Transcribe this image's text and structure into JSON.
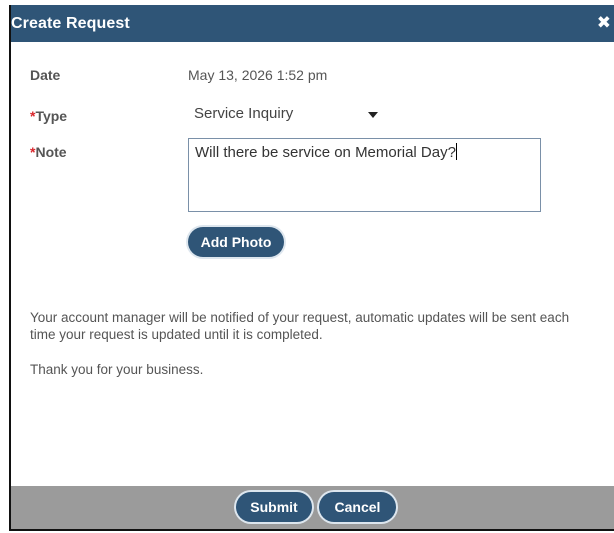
{
  "dialog": {
    "title": "Create Request",
    "close_symbol": "✖"
  },
  "form": {
    "date_label": "Date",
    "date_value": "May 13, 2026 1:52 pm",
    "required_mark": "*",
    "type_label": "Type",
    "type_value": "Service Inquiry",
    "note_label": "Note",
    "note_value": "Will there be service on Memorial Day?",
    "add_photo_label": "Add Photo"
  },
  "messages": {
    "notice": "Your account manager will be notified of your request, automatic updates will be sent each time your request is updated until it is completed.",
    "thanks": "Thank you for your business."
  },
  "footer": {
    "submit_label": "Submit",
    "cancel_label": "Cancel"
  },
  "colors": {
    "titlebar": "#2f5577",
    "button": "#2f5577",
    "required": "#d9262c",
    "footer": "#9b9b9b"
  }
}
